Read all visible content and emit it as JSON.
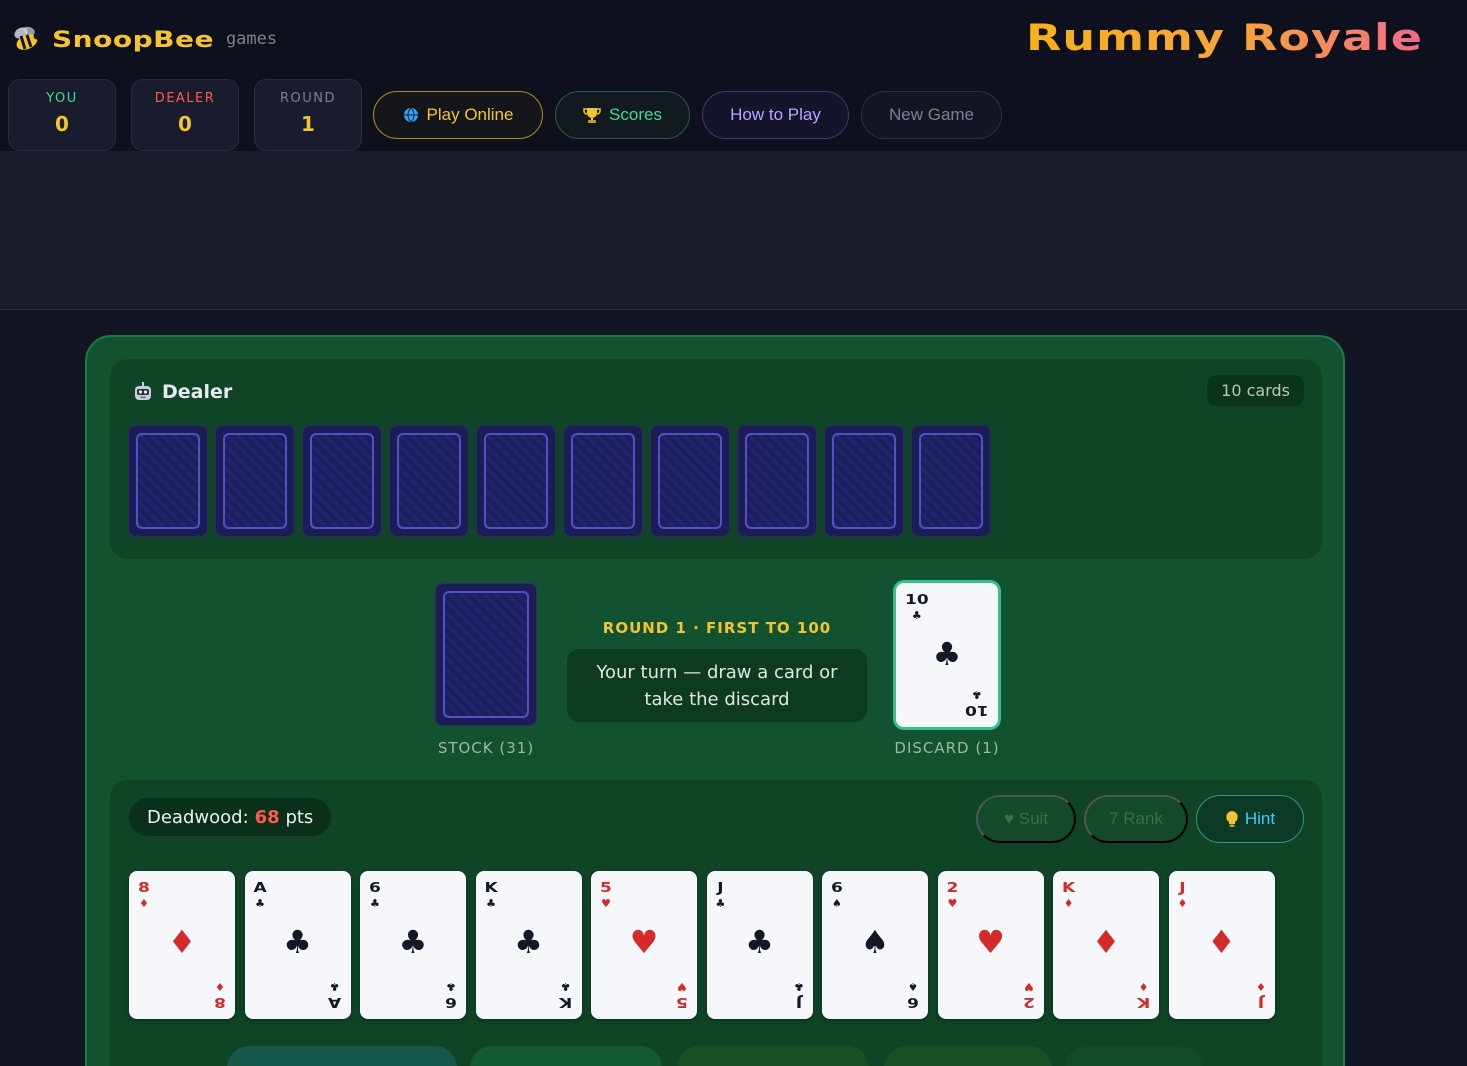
{
  "brand": {
    "name": "SnoopBee",
    "sub": "games"
  },
  "game_title": "Rummy Royale",
  "stats": [
    {
      "label": "YOU",
      "value": "0",
      "color": "#3ddc97"
    },
    {
      "label": "DEALER",
      "value": "0",
      "color": "#ff5a4e"
    },
    {
      "label": "ROUND",
      "value": "1",
      "color": "#7c8091"
    }
  ],
  "nav": {
    "play_online": "Play Online",
    "scores": "Scores",
    "how_to_play": "How to Play",
    "new_game": "New Game"
  },
  "dealer": {
    "title": "Dealer",
    "card_count": "10 cards",
    "cards_face_down": 10
  },
  "stock": {
    "label": "STOCK (31)"
  },
  "round_info": "ROUND 1 · FIRST TO 100",
  "turn_message": "Your turn — draw a card or take the discard",
  "discard": {
    "label": "DISCARD (1)",
    "top_card": {
      "rank": "10",
      "suit": "♣",
      "color": "black"
    }
  },
  "hand": {
    "deadwood_label": "Deadwood:",
    "deadwood_value": "68",
    "deadwood_unit": "pts",
    "sort_suit": "♥ Suit",
    "sort_rank": "7 Rank",
    "hint": "Hint",
    "cards": [
      {
        "rank": "8",
        "suit": "♦",
        "color": "red"
      },
      {
        "rank": "A",
        "suit": "♣",
        "color": "black"
      },
      {
        "rank": "6",
        "suit": "♣",
        "color": "black"
      },
      {
        "rank": "K",
        "suit": "♣",
        "color": "black"
      },
      {
        "rank": "5",
        "suit": "♥",
        "color": "red"
      },
      {
        "rank": "J",
        "suit": "♣",
        "color": "black"
      },
      {
        "rank": "6",
        "suit": "♠",
        "color": "black"
      },
      {
        "rank": "2",
        "suit": "♥",
        "color": "red"
      },
      {
        "rank": "K",
        "suit": "♦",
        "color": "red"
      },
      {
        "rank": "J",
        "suit": "♦",
        "color": "red"
      }
    ]
  },
  "icons": {
    "brand": "bee-icon",
    "play_online": "globe-icon",
    "scores": "trophy-icon",
    "dealer": "robot-icon",
    "hint": "lightbulb-icon"
  }
}
